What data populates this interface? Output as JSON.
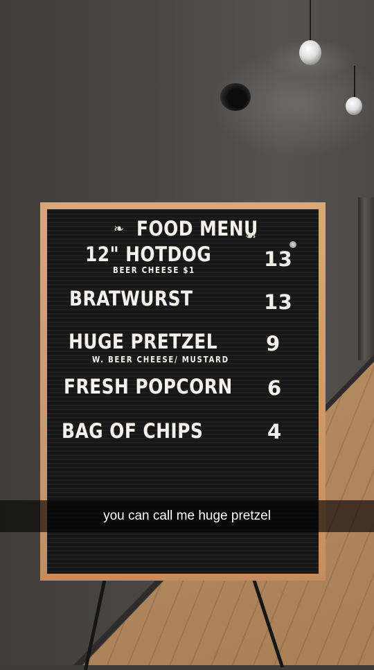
{
  "menu_board": {
    "title": "FOOD MENU",
    "title_ornament_left": "❧",
    "title_ornament_right": "☙",
    "items": [
      {
        "name": "12\" HOTDOG",
        "note": "BEER CHEESE $1",
        "price": "13"
      },
      {
        "name": "BRATWURST",
        "note": "",
        "price": "13"
      },
      {
        "name": "HUGE  PRETZEL",
        "note": "W. BEER CHEESE/ MUSTARD",
        "price": "9"
      },
      {
        "name": "FRESH POPCORN",
        "note": "",
        "price": "6"
      },
      {
        "name": "BAG OF CHIPS",
        "note": "",
        "price": "4"
      }
    ]
  },
  "caption": {
    "text": "you can call me huge pretzel"
  },
  "colors": {
    "board": "#171717",
    "frame": "#d9a77a",
    "letters": "#f3f1ec",
    "wall": "#4a4845",
    "floor": "#c49b72"
  }
}
